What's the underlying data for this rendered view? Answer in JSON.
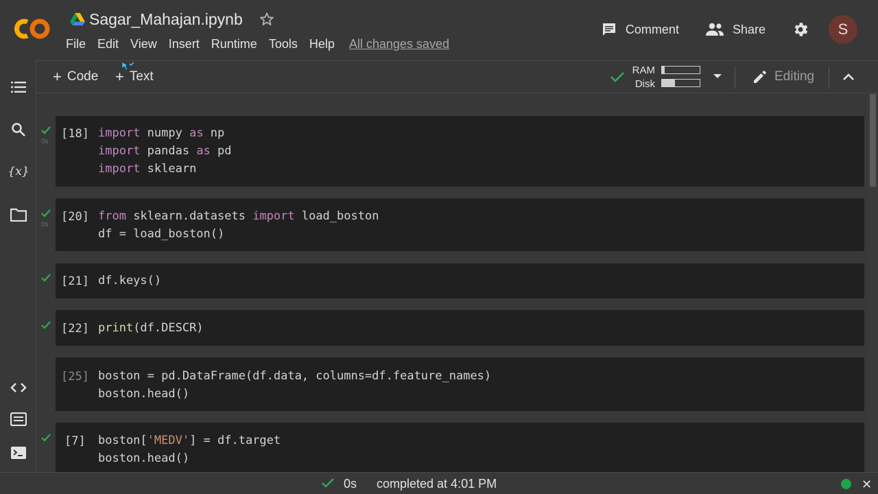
{
  "header": {
    "notebook_title": "Sagar_Mahajan.ipynb",
    "menu": [
      "File",
      "Edit",
      "View",
      "Insert",
      "Runtime",
      "Tools",
      "Help"
    ],
    "save_status": "All changes saved",
    "comment_label": "Comment",
    "share_label": "Share",
    "avatar_initial": "S"
  },
  "toolbar": {
    "code_label": "Code",
    "text_label": "Text",
    "ram_label": "RAM",
    "disk_label": "Disk",
    "ram_usage": 0.08,
    "disk_usage": 0.35,
    "editing_label": "Editing"
  },
  "cells": [
    {
      "exec": "[18]",
      "time": "0s",
      "ran": true,
      "lines": [
        "import numpy as np",
        "import pandas as pd",
        "import sklearn"
      ]
    },
    {
      "exec": "[20]",
      "time": "0s",
      "ran": true,
      "lines": [
        "from sklearn.datasets import load_boston",
        "df = load_boston()"
      ]
    },
    {
      "exec": "[21]",
      "time": "",
      "ran": true,
      "lines": [
        "df.keys()"
      ]
    },
    {
      "exec": "[22]",
      "time": "",
      "ran": true,
      "lines": [
        "print(df.DESCR)"
      ]
    },
    {
      "exec": "[25]",
      "time": "",
      "ran": false,
      "lines": [
        "boston = pd.DataFrame(df.data, columns=df.feature_names)",
        "boston.head()"
      ]
    },
    {
      "exec": "[7]",
      "time": "",
      "ran": true,
      "lines": [
        "boston['MEDV'] = df.target",
        "boston.head()"
      ]
    }
  ],
  "statusbar": {
    "duration": "0s",
    "completed_text": "completed at 4:01 PM"
  },
  "colors": {
    "background": "#383838",
    "cell_background": "#202020",
    "keyword": "#c586c0",
    "string": "#ce9178",
    "success_green": "#34a853",
    "logo_orange": "#f9ab00"
  }
}
